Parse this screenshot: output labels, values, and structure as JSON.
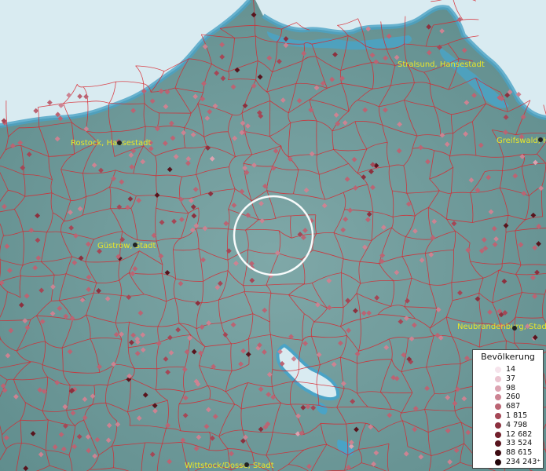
{
  "cities": [
    {
      "id": "rostock",
      "label": "Rostock, Hansestadt"
    },
    {
      "id": "stralsund",
      "label": "Stralsund, Hansestadt"
    },
    {
      "id": "greifswald",
      "label": "Greifswald, H"
    },
    {
      "id": "guestrow",
      "label": "Güstrow, Stadt"
    },
    {
      "id": "neubrandenburg",
      "label": "Neubrandenburg, Stadt"
    },
    {
      "id": "wittstock",
      "label": "Wittstock/Dosse, Stadt"
    }
  ],
  "legend": {
    "title": "Bevölkerung",
    "items": [
      {
        "label": "14",
        "color": "#f6e4ec"
      },
      {
        "label": "37",
        "color": "#ebc4d0"
      },
      {
        "label": "98",
        "color": "#dca3b1"
      },
      {
        "label": "260",
        "color": "#cc8392"
      },
      {
        "label": "687",
        "color": "#bb6473"
      },
      {
        "label": "1 815",
        "color": "#a54756"
      },
      {
        "label": "4 798",
        "color": "#8c303e"
      },
      {
        "label": "12 682",
        "color": "#72202b"
      },
      {
        "label": "33 524",
        "color": "#58141d"
      },
      {
        "label": "88 615",
        "color": "#3e0c12"
      },
      {
        "label": "234 243⁺",
        "color": "#24060a"
      }
    ]
  },
  "colors": {
    "sea": "#d9ebf1",
    "land": "#6f9a9a",
    "water": "#4aa3c6",
    "borders": "#d8262e",
    "highlight": "#ffffff"
  }
}
